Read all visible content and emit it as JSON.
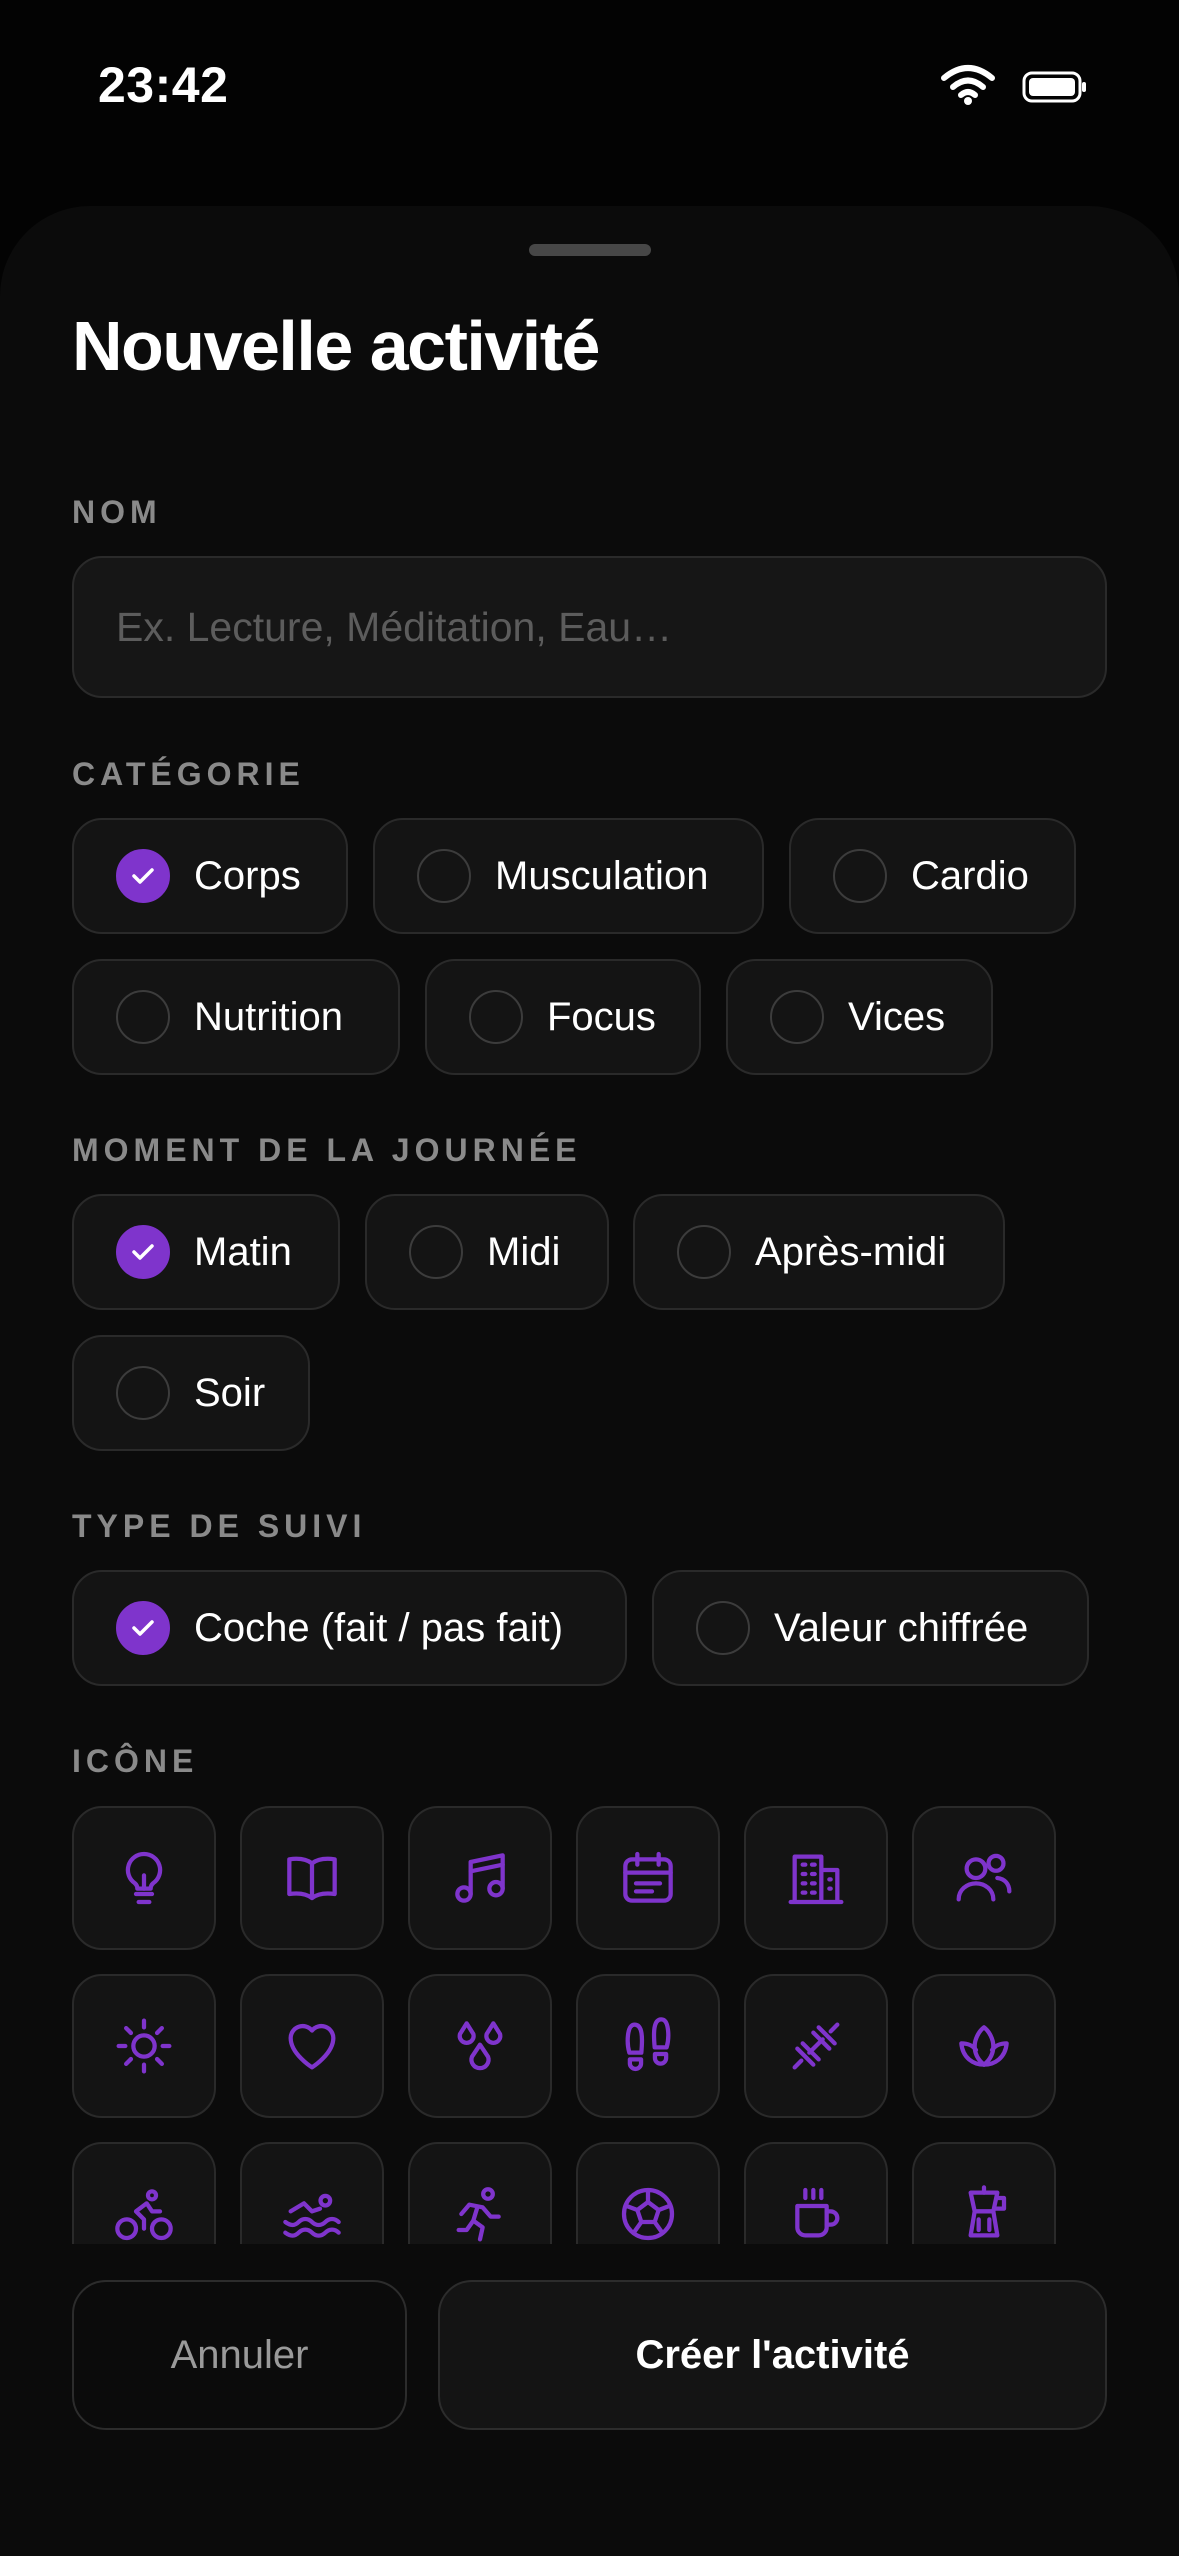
{
  "status_bar": {
    "time": "23:42"
  },
  "sheet": {
    "title": "Nouvelle activité",
    "name_section": {
      "label": "NOM",
      "placeholder": "Ex. Lecture, Méditation, Eau…",
      "value": ""
    },
    "category_section": {
      "label": "CATÉGORIE",
      "options": [
        {
          "label": "Corps",
          "selected": true
        },
        {
          "label": "Musculation",
          "selected": false
        },
        {
          "label": "Cardio",
          "selected": false
        },
        {
          "label": "Nutrition",
          "selected": false
        },
        {
          "label": "Focus",
          "selected": false
        },
        {
          "label": "Vices",
          "selected": false
        }
      ]
    },
    "time_section": {
      "label": "MOMENT DE LA JOURNÉE",
      "options": [
        {
          "label": "Matin",
          "selected": true
        },
        {
          "label": "Midi",
          "selected": false
        },
        {
          "label": "Après-midi",
          "selected": false
        },
        {
          "label": "Soir",
          "selected": false
        }
      ]
    },
    "tracking_section": {
      "label": "TYPE DE SUIVI",
      "options": [
        {
          "label": "Coche (fait / pas fait)",
          "selected": true
        },
        {
          "label": "Valeur chiffrée",
          "selected": false
        }
      ]
    },
    "icon_section": {
      "label": "ICÔNE",
      "icons": [
        "lightbulb-icon",
        "book-icon",
        "music-icon",
        "calendar-icon",
        "building-icon",
        "users-icon",
        "sun-icon",
        "heart-icon",
        "droplets-icon",
        "footprints-icon",
        "dumbbell-icon",
        "lotus-icon",
        "bike-icon",
        "swim-icon",
        "run-icon",
        "ball-icon",
        "coffee-icon",
        "moka-pot-icon"
      ]
    }
  },
  "actions": {
    "cancel_label": "Annuler",
    "create_label": "Créer l'activité"
  },
  "colors": {
    "accent": "#7F34CC",
    "background": "#0B0B0B",
    "surface": "#141414",
    "border": "#2A2A2A"
  }
}
